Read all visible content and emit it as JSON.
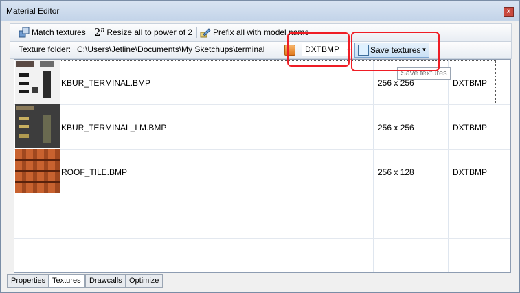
{
  "window": {
    "title": "Material Editor",
    "close_glyph": "x"
  },
  "toolbar": {
    "match_textures": "Match textures",
    "resize_superscript": "n",
    "resize_label": "Resize all to power of 2",
    "prefix_label": "Prefix all with model name"
  },
  "folderbar": {
    "label": "Texture folder:",
    "path": "C:\\Users\\Jetline\\Documents\\My Sketchups\\terminal",
    "format": "DXTBMP",
    "save_label": "Save textures",
    "tooltip": "Save textures"
  },
  "textures": [
    {
      "name": "KBUR_TERMINAL.BMP",
      "size": "256 x 256",
      "format": "DXTBMP"
    },
    {
      "name": "KBUR_TERMINAL_LM.BMP",
      "size": "256 x 256",
      "format": "DXTBMP"
    },
    {
      "name": "ROOF_TILE.BMP",
      "size": "256 x 128",
      "format": "DXTBMP"
    }
  ],
  "tabs": [
    {
      "label": "Properties"
    },
    {
      "label": "Textures",
      "active": true
    },
    {
      "label": "Drawcalls"
    },
    {
      "label": "Optimize"
    }
  ],
  "colors": {
    "highlight": "#ef1d25",
    "titlebar": "#c2d3e8"
  }
}
